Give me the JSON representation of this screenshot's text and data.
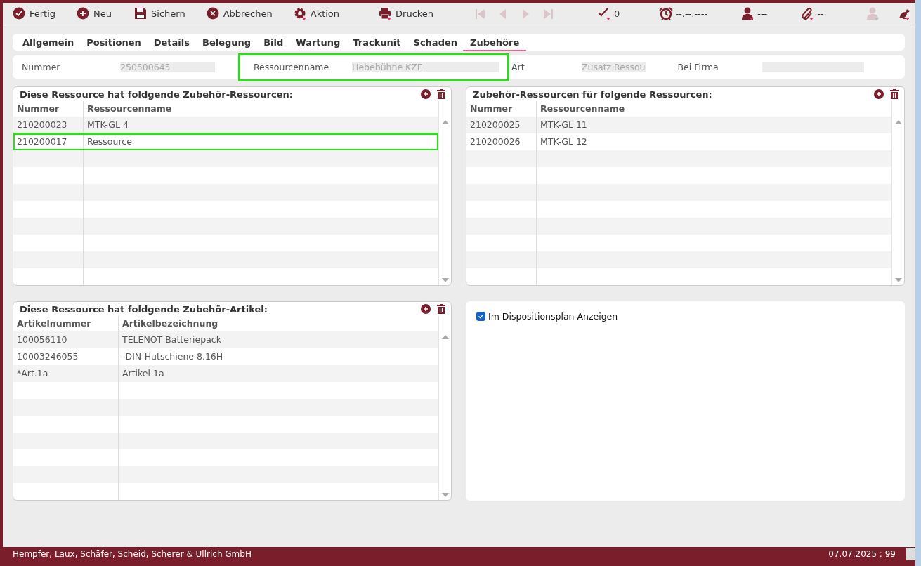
{
  "toolbar": {
    "actions": [
      {
        "label": "Fertig"
      },
      {
        "label": "Neu"
      },
      {
        "label": "Sichern"
      },
      {
        "label": "Abbrechen"
      },
      {
        "label": "Aktion"
      },
      {
        "label": "Drucken"
      }
    ],
    "navigation": [
      {
        "disabled": true
      },
      {
        "disabled": true
      },
      {
        "disabled": true
      },
      {
        "disabled": true
      }
    ],
    "indicators": [
      {
        "text": "0"
      },
      {
        "text": "--.--.----"
      },
      {
        "text": "---"
      },
      {
        "text": "--"
      }
    ],
    "tools": [
      {
        "disabled": true
      },
      {
        "disabled": false
      }
    ]
  },
  "tabs": [
    {
      "label": "Allgemein",
      "selected": false
    },
    {
      "label": "Positionen",
      "selected": false
    },
    {
      "label": "Details",
      "selected": false
    },
    {
      "label": "Belegung",
      "selected": false
    },
    {
      "label": "Bild",
      "selected": false
    },
    {
      "label": "Wartung",
      "selected": false
    },
    {
      "label": "Trackunit",
      "selected": false
    },
    {
      "label": "Schaden",
      "selected": false
    },
    {
      "label": "Zubehöre",
      "selected": true
    }
  ],
  "fields": [
    {
      "label": "Nummer",
      "value": "250500645",
      "highlighted": false
    },
    {
      "label": "Ressourcenname",
      "value": "Hebebühne KZE",
      "highlighted": true
    },
    {
      "label": "Art",
      "value": "Zusatz Ressou",
      "highlighted": false
    },
    {
      "label": "Bei Firma",
      "highlighted": false
    }
  ],
  "panels": [
    {
      "title": "Diese Ressource hat foldgende Zubehör-Ressourcen:",
      "columns": [
        "Nummer",
        "Ressourcenname"
      ],
      "rows": [
        {
          "cells": [
            "210200023",
            "MTK-GL 4"
          ],
          "highlighted": false
        },
        {
          "cells": [
            "210200017",
            "Ressource"
          ],
          "highlighted": true
        }
      ]
    },
    {
      "title": "Zubehör-Ressourcen für folgende Ressourcen:",
      "columns": [
        "Nummer",
        "Ressourcenname"
      ],
      "rows": [
        {
          "cells": [
            "210200025",
            "MTK-GL 11"
          ],
          "highlighted": false
        },
        {
          "cells": [
            "210200026",
            "MTK-GL 12"
          ],
          "highlighted": false
        }
      ]
    },
    {
      "title": "Diese Ressource hat foldgende Zubehör-Artikel:",
      "columns": [
        "Artikelnummer",
        "Artikelbezeichnung"
      ],
      "rows": [
        {
          "cells": [
            "100056110",
            "TELENOT Batteriepack"
          ],
          "highlighted": false
        },
        {
          "cells": [
            "10003246055",
            "-DIN-Hutschiene 8.16H"
          ],
          "highlighted": false
        },
        {
          "cells": [
            "*Art.1a",
            "Artikel 1a"
          ],
          "highlighted": false
        }
      ]
    }
  ],
  "options": {
    "checkbox": {
      "label": "Im Dispositionsplan Anzeigen",
      "checked": true
    }
  },
  "status_bar": {
    "company": "Hempfer, Laux, Schäfer, Scheid, Scherer & Ullrich GmbH",
    "date": "07.07.2025 : 99"
  }
}
